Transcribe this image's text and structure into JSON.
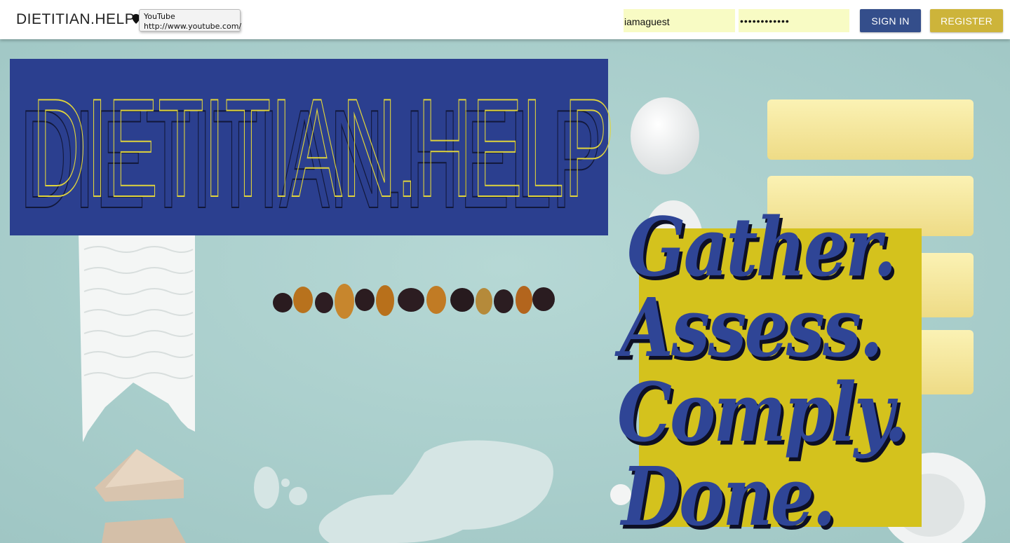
{
  "header": {
    "brand": "DIETITIAN.HELP",
    "tooltip": {
      "title": "YouTube",
      "url": "http://www.youtube.com/"
    },
    "login": {
      "username_value": "iamaguest",
      "password_value": "••••••••••••"
    },
    "buttons": {
      "sign_in": "SIGN IN",
      "register": "REGISTER"
    }
  },
  "hero": {
    "logo_text": "DIETITIAN.HELP",
    "slogan": [
      "Gather.",
      "Assess.",
      "Comply.",
      "Done."
    ]
  },
  "colors": {
    "logo_block": "#2b3f8f",
    "slogan_block": "#d4c21d",
    "slogan_text": "#2f4596",
    "sign_in_button": "#344e8b",
    "register_button": "#cdb43a",
    "input_background": "#f8fbc4",
    "hero_background": "#a9cecc"
  }
}
